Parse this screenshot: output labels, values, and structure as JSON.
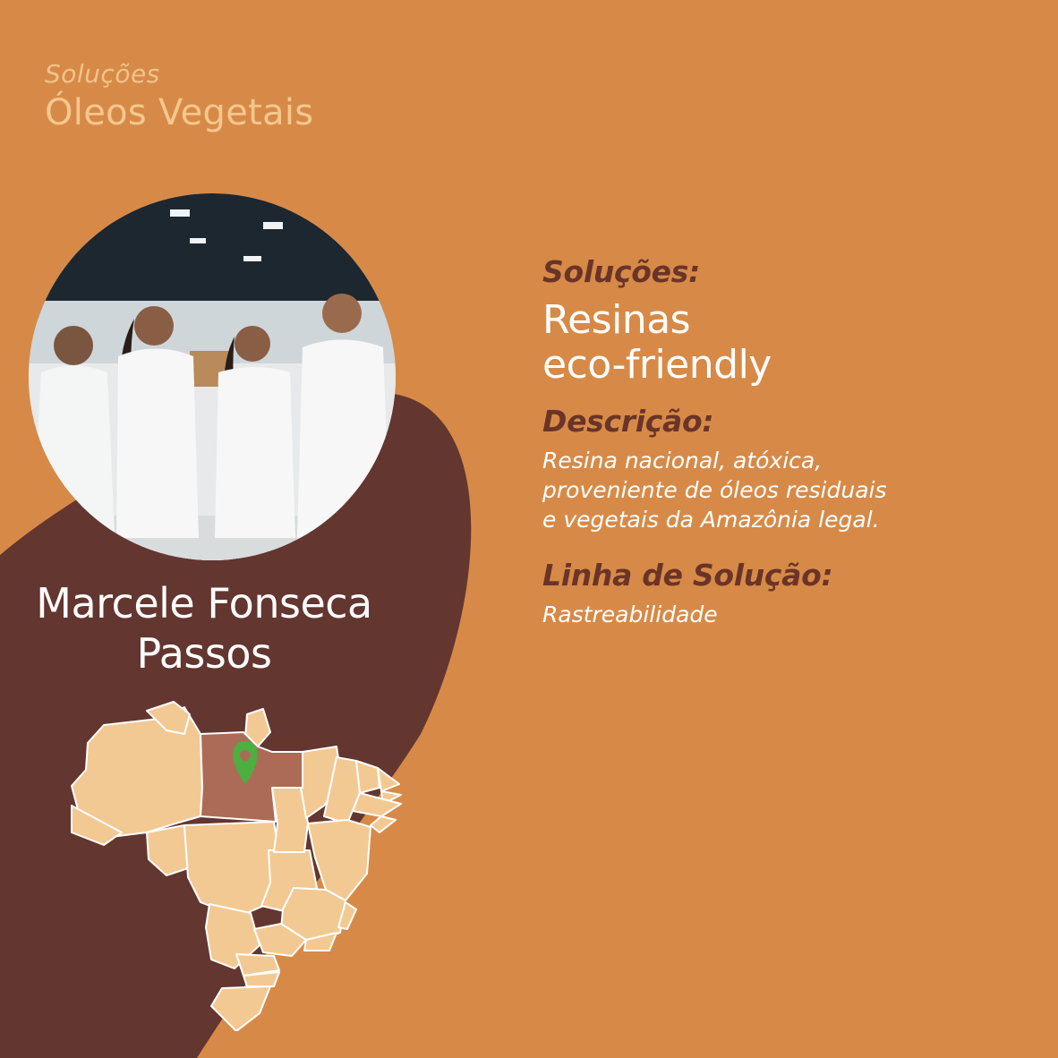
{
  "header": {
    "subtitle": "Soluções",
    "title": "Óleos Vegetais"
  },
  "person": {
    "name_line1": "Marcele Fonseca",
    "name_line2": "Passos"
  },
  "info": {
    "solutions_label": "Soluções:",
    "solution_line1": "Resinas",
    "solution_line2": "eco-friendly",
    "description_label": "Descrição:",
    "description_lines": [
      "Resina nacional, atóxica,",
      "proveniente de óleos residuais",
      "e vegetais da Amazônia legal."
    ],
    "line_label": "Linha de Solução:",
    "line_value": "Rastreabilidade"
  },
  "colors": {
    "background": "#d78a47",
    "dark_shape": "#633630",
    "map_fill": "#f3c993",
    "highlight_state": "#ac6b57",
    "pin": "#4caf3f",
    "label": "#6a3428"
  },
  "map": {
    "highlighted_state": "Pará",
    "marker_icon": "location-pin-icon"
  }
}
